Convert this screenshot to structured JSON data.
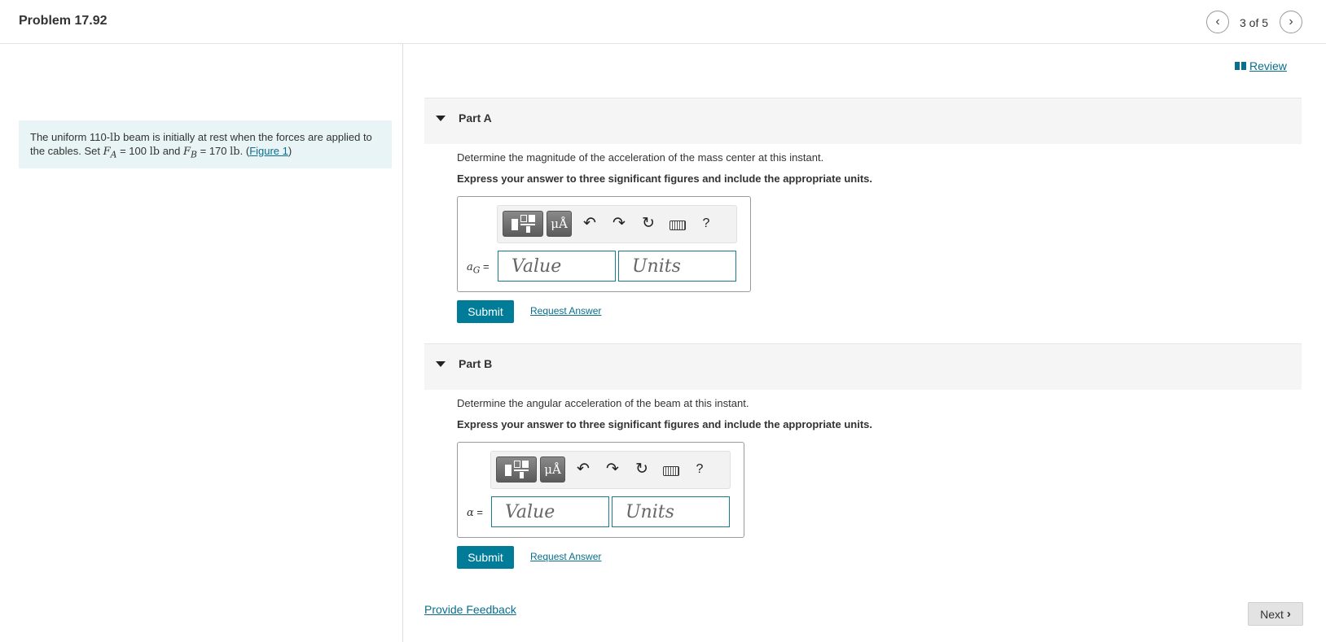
{
  "header": {
    "title": "Problem 17.92",
    "page_count": "3 of 5",
    "prev_icon": "‹",
    "next_icon": "›"
  },
  "problem": {
    "text_1": "The uniform 110-",
    "unit_lb": "lb",
    "text_2": " beam is initially at rest when the forces are applied to the cables. Set ",
    "fa_symbol": "F",
    "fa_sub": "A",
    "fa_value": " = 100 ",
    "text_3": " and ",
    "fb_symbol": "F",
    "fb_sub": "B",
    "fb_value": " = 170 ",
    "text_4": ". (",
    "figure_link": "Figure 1",
    "text_5": ")"
  },
  "review": {
    "label": " Review"
  },
  "part_a": {
    "title": "Part A",
    "question": "Determine the magnitude of the acceleration of the mass center at this instant.",
    "instruction": "Express your answer to three significant figures and include the appropriate units.",
    "var_symbol": "a",
    "var_sub": "G",
    "var_eq": " =",
    "value_placeholder": "Value",
    "units_placeholder": "Units",
    "submit_label": "Submit",
    "request_label": "Request Answer"
  },
  "part_b": {
    "title": "Part B",
    "question": "Determine the angular acceleration of the beam at this instant.",
    "instruction": "Express your answer to three significant figures and include the appropriate units.",
    "var_symbol": "α",
    "var_eq": " =",
    "value_placeholder": "Value",
    "units_placeholder": "Units",
    "submit_label": "Submit",
    "request_label": "Request Answer"
  },
  "toolbar": {
    "units_label": "μÅ",
    "undo_icon": "↶",
    "redo_icon": "↷",
    "reset_icon": "↻",
    "help_label": "?"
  },
  "footer": {
    "feedback_label": "Provide Feedback",
    "next_label": "Next",
    "next_chevron": "›"
  }
}
